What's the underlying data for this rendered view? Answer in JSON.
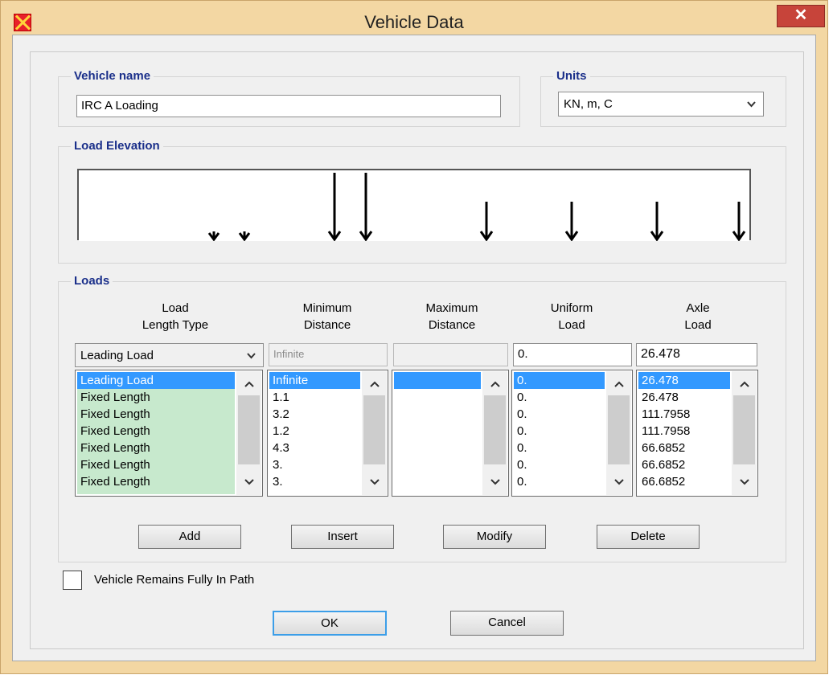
{
  "window": {
    "title": "Vehicle Data",
    "close_glyph": "✕"
  },
  "vehicle_name": {
    "label": "Vehicle name",
    "value": "IRC A Loading"
  },
  "units": {
    "label": "Units",
    "selected": "KN, m, C"
  },
  "load_elevation": {
    "label": "Load Elevation",
    "arrow_color": "#000000"
  },
  "loads": {
    "label": "Loads",
    "headers": {
      "length_type": [
        "Load",
        "Length Type"
      ],
      "min_distance": [
        "Minimum",
        "Distance"
      ],
      "max_distance": [
        "Maximum",
        "Distance"
      ],
      "uniform_load": [
        "Uniform",
        "Load"
      ],
      "axle_load": [
        "Axle",
        "Load"
      ]
    },
    "edit": {
      "length_type": "Leading Load",
      "min_distance": "Infinite",
      "max_distance": "",
      "uniform_load": "0.",
      "axle_load": "26.478"
    },
    "length_types": [
      "Leading Load",
      "Fixed Length",
      "Fixed Length",
      "Fixed Length",
      "Fixed Length",
      "Fixed Length",
      "Fixed Length"
    ],
    "min_distances": [
      "Infinite",
      "1.1",
      "3.2",
      "1.2",
      "4.3",
      "3.",
      "3."
    ],
    "max_distances": [
      ""
    ],
    "uniform_loads": [
      "0.",
      "0.",
      "0.",
      "0.",
      "0.",
      "0.",
      "0."
    ],
    "axle_loads": [
      "26.478",
      "26.478",
      "111.7958",
      "111.7958",
      "66.6852",
      "66.6852",
      "66.6852"
    ],
    "selection_color": "#3399ff",
    "list_green": "#c7e9cd"
  },
  "buttons": {
    "add": "Add",
    "insert": "Insert",
    "modify": "Modify",
    "delete": "Delete",
    "ok": "OK",
    "cancel": "Cancel"
  },
  "options": {
    "remains_in_path_label": "Vehicle Remains Fully In Path",
    "remains_in_path_checked": false
  },
  "icons": {
    "app": "sap-logo-icon",
    "dropdown": "chevron-down-icon",
    "scroll_up": "chevron-up-icon",
    "scroll_down": "chevron-down-icon"
  }
}
